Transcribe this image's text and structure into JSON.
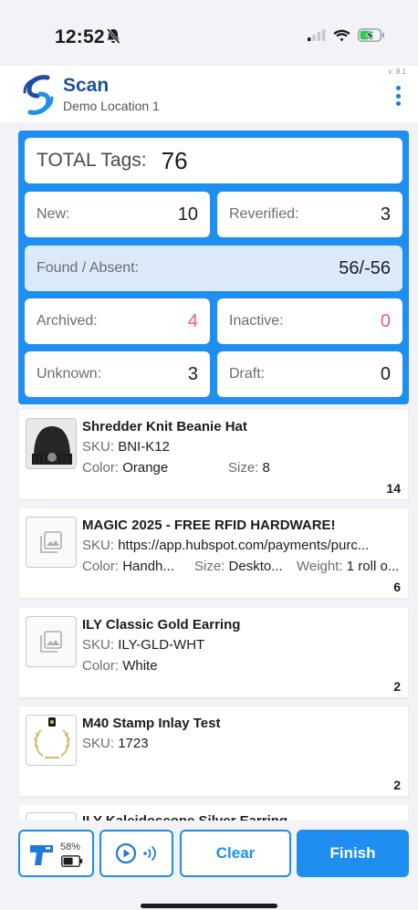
{
  "status_bar": {
    "time": "12:52"
  },
  "header": {
    "title": "Scan",
    "subtitle": "Demo Location 1",
    "version": "v: 8.1"
  },
  "stats": {
    "total_label": "TOTAL Tags:",
    "total_value": "76",
    "new_label": "New:",
    "new_value": "10",
    "reverified_label": "Reverified:",
    "reverified_value": "3",
    "found_label": "Found / Absent:",
    "found_value": "56/-56",
    "archived_label": "Archived:",
    "archived_value": "4",
    "inactive_label": "Inactive:",
    "inactive_value": "0",
    "unknown_label": "Unknown:",
    "unknown_value": "3",
    "draft_label": "Draft:",
    "draft_value": "0",
    "colors": {
      "panel": "#1e8ef0",
      "highlight_red": "#ea5b7a"
    }
  },
  "items": [
    {
      "name": "Shredder Knit Beanie Hat",
      "sku_label": "SKU:",
      "sku": "BNI-K12",
      "color_label": "Color:",
      "color": "Orange",
      "size_label": "Size:",
      "size": "8",
      "count": "14"
    },
    {
      "name": "MAGIC 2025 - FREE RFID HARDWARE!",
      "sku_label": "SKU:",
      "sku": "https://app.hubspot.com/payments/purc...",
      "color_label": "Color:",
      "color": "Handh...",
      "size_label": "Size:",
      "size": "Deskto...",
      "weight_label": "Weight:",
      "weight": "1 roll o...",
      "count": "6"
    },
    {
      "name": "ILY Classic Gold Earring",
      "sku_label": "SKU:",
      "sku": "ILY-GLD-WHT",
      "color_label": "Color:",
      "color": "White",
      "count": "2"
    },
    {
      "name": "M40 Stamp Inlay Test",
      "sku_label": "SKU:",
      "sku": "1723",
      "count": "2"
    },
    {
      "name": "ILY Kaleidoscope Silver Earring"
    }
  ],
  "bottom": {
    "battery": "58%",
    "clear_label": "Clear",
    "finish_label": "Finish"
  },
  "icons": [
    "bell-slash-icon",
    "signal-icon",
    "wifi-icon",
    "battery-charging-icon",
    "menu-dots-icon",
    "image-placeholder-icon",
    "rfid-reader-icon",
    "battery-icon",
    "play-icon",
    "rfid-signal-icon"
  ]
}
